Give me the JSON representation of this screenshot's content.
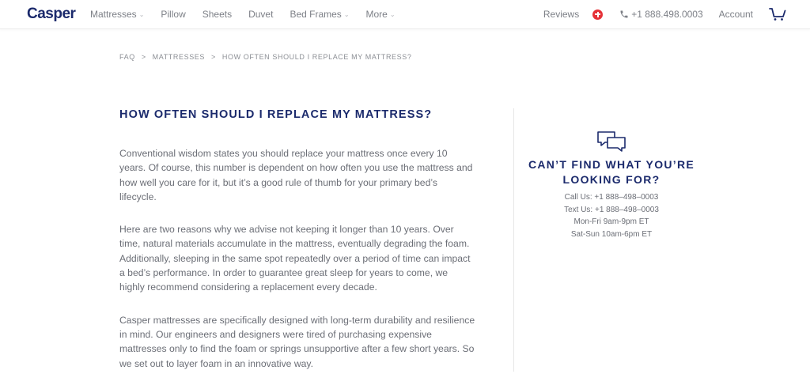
{
  "header": {
    "logo": "Casper",
    "nav": [
      {
        "label": "Mattresses",
        "dropdown": true
      },
      {
        "label": "Pillow",
        "dropdown": false
      },
      {
        "label": "Sheets",
        "dropdown": false
      },
      {
        "label": "Duvet",
        "dropdown": false
      },
      {
        "label": "Bed Frames",
        "dropdown": true
      },
      {
        "label": "More",
        "dropdown": true
      }
    ],
    "reviews": "Reviews",
    "phone": "+1 888.498.0003",
    "account": "Account",
    "icons": {
      "locale": "canada-flag-icon",
      "phone": "phone-icon",
      "cart": "cart-icon"
    }
  },
  "breadcrumb": [
    "FAQ",
    "MATTRESSES",
    "HOW OFTEN SHOULD I REPLACE MY MATTRESS?"
  ],
  "breadcrumb_separator": ">",
  "article": {
    "title": "HOW OFTEN SHOULD I REPLACE MY MATTRESS?",
    "paragraphs": [
      "Conventional wisdom states you should replace your mattress once every 10 years. Of course, this number is dependent on how often you use the mattress and how well you care for it, but it’s a good rule of thumb for your primary bed’s lifecycle.",
      "Here are two reasons why we advise not keeping it longer than 10 years. Over time, natural materials accumulate in the mattress, eventually degrading the foam. Additionally, sleeping in the same spot repeatedly over a period of time can impact a bed’s performance. In order to guarantee great sleep for years to come, we highly recommend considering a replacement every decade.",
      "Casper mattresses are specifically designed with long-term durability and resilience in mind. Our engineers and designers were tired of purchasing expensive mattresses only to find the foam or springs unsupportive after a few short years. So we set out to layer foam in an innovative way."
    ]
  },
  "help": {
    "icon": "chat-bubbles-icon",
    "title": "CAN’T FIND WHAT YOU’RE LOOKING FOR?",
    "lines": [
      "Call Us: +1 888–498–0003",
      "Text Us: +1 888–498–0003",
      "Mon-Fri 9am-9pm ET",
      "Sat-Sun 10am-6pm ET"
    ]
  },
  "colors": {
    "brand": "#1b2a6c",
    "text": "#6b6e76",
    "flag": "#e53238"
  }
}
